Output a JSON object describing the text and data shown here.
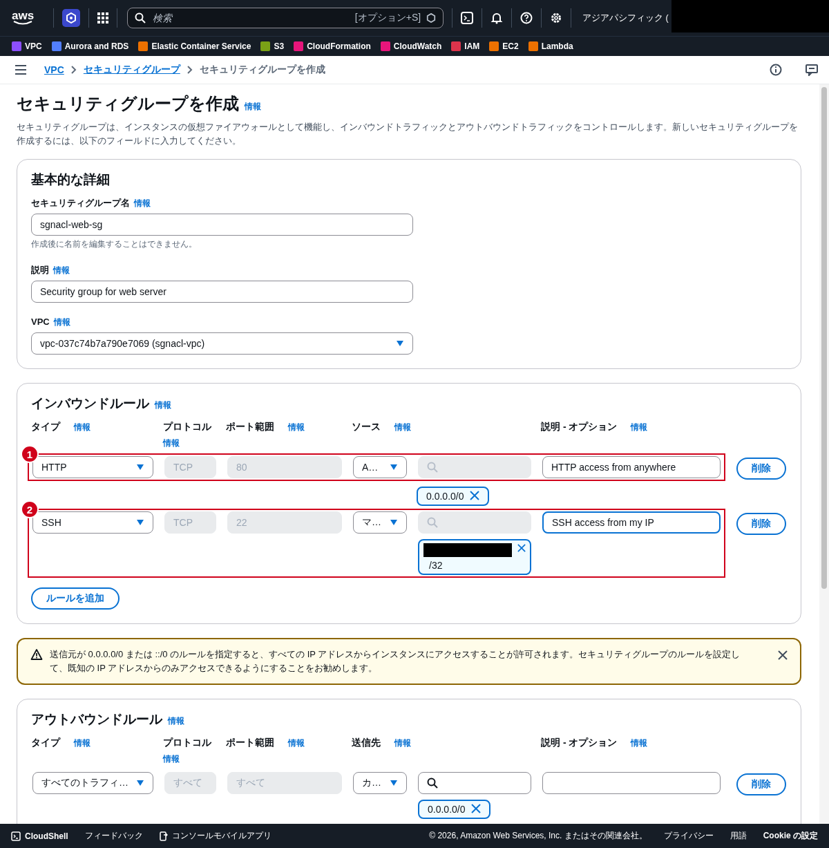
{
  "top_nav": {
    "logo": "aws",
    "search": {
      "placeholder": "検索",
      "shortcut": "[オプション+S]"
    },
    "region": "アジアパシフィック ("
  },
  "favorites": [
    {
      "label": "VPC",
      "color": "#8c4fff"
    },
    {
      "label": "Aurora and RDS",
      "color": "#527fff"
    },
    {
      "label": "Elastic Container Service",
      "color": "#ed7100"
    },
    {
      "label": "S3",
      "color": "#7aa116"
    },
    {
      "label": "CloudFormation",
      "color": "#e7157b"
    },
    {
      "label": "CloudWatch",
      "color": "#e7157b"
    },
    {
      "label": "IAM",
      "color": "#dd344c"
    },
    {
      "label": "EC2",
      "color": "#ed7100"
    },
    {
      "label": "Lambda",
      "color": "#ed7100"
    }
  ],
  "breadcrumbs": [
    {
      "label": "VPC",
      "kind": "link"
    },
    {
      "label": "セキュリティグループ",
      "kind": "link"
    },
    {
      "label": "セキュリティグループを作成",
      "kind": "current"
    }
  ],
  "page": {
    "title": "セキュリティグループを作成",
    "info": "情報",
    "description": "セキュリティグループは、インスタンスの仮想ファイアウォールとして機能し、インバウンドトラフィックとアウトバウンドトラフィックをコントロールします。新しいセキュリティグループを作成するには、以下のフィールドに入力してください。"
  },
  "basic_details": {
    "title": "基本的な詳細",
    "fields": [
      {
        "kind": "input",
        "label": "セキュリティグループ名",
        "info": "情報",
        "value": "sgnacl-web-sg",
        "hint": "作成後に名前を編集することはできません。"
      },
      {
        "kind": "input",
        "label": "説明",
        "info": "情報",
        "value": "Security group for web server"
      },
      {
        "kind": "select",
        "label": "VPC",
        "info": "情報",
        "value": "vpc-037c74b7a790e7069 (sgnacl-vpc)"
      }
    ]
  },
  "inbound": {
    "title": "インバウンドルール",
    "info": "情報",
    "headers": [
      {
        "label": "タイプ",
        "info": "情報"
      },
      {
        "label": "プロトコル",
        "info": "情報"
      },
      {
        "label": "ポート範囲",
        "info": "情報"
      },
      {
        "label": "ソース",
        "info": "情報"
      },
      {
        "label": "説明 - オプション",
        "info": "情報"
      }
    ],
    "rules": [
      {
        "annotation": {
          "number": "1",
          "covers_tokens": false
        },
        "type": "HTTP",
        "protocol": "TCP",
        "port": "80",
        "source": "A…",
        "search_disabled": true,
        "tokens": [
          {
            "text": "0.0.0.0/0",
            "redacted": false
          }
        ],
        "description": "HTTP access from anywhere",
        "focused": false,
        "delete": "削除"
      },
      {
        "annotation": {
          "number": "2",
          "covers_tokens": true
        },
        "type": "SSH",
        "protocol": "TCP",
        "port": "22",
        "source": "マ…",
        "search_disabled": true,
        "tokens": [
          {
            "text": "/32",
            "redacted": true
          }
        ],
        "description": "SSH access from my IP",
        "focused": true,
        "delete": "削除"
      }
    ],
    "add_button": "ルールを追加"
  },
  "warning": {
    "text": "送信元が 0.0.0.0/0 または ::/0 のルールを指定すると、すべての IP アドレスからインスタンスにアクセスすることが許可されます。セキュリティグループのルールを設定して、既知の IP アドレスからのみアクセスできるようにすることをお勧めします。"
  },
  "outbound": {
    "title": "アウトバウンドルール",
    "info": "情報",
    "headers": [
      {
        "label": "タイプ",
        "info": "情報"
      },
      {
        "label": "プロトコル",
        "info": "情報"
      },
      {
        "label": "ポート範囲",
        "info": "情報"
      },
      {
        "label": "送信先",
        "info": "情報"
      },
      {
        "label": "説明 - オプション",
        "info": "情報"
      }
    ],
    "rules": [
      {
        "type": "すべてのトラフィ…",
        "protocol": "すべて",
        "port": "すべて",
        "source": "カ…",
        "search_disabled": false,
        "tokens": [
          {
            "text": "0.0.0.0/0",
            "redacted": false
          }
        ],
        "focused": false,
        "delete": "削除"
      }
    ]
  },
  "footer": {
    "cloudshell": "CloudShell",
    "feedback": "フィードバック",
    "mobile_app": "コンソールモバイルアプリ",
    "copyright": "© 2026, Amazon Web Services, Inc. またはその関連会社。",
    "links": [
      "プライバシー",
      "用語",
      "Cookie の設定"
    ]
  }
}
